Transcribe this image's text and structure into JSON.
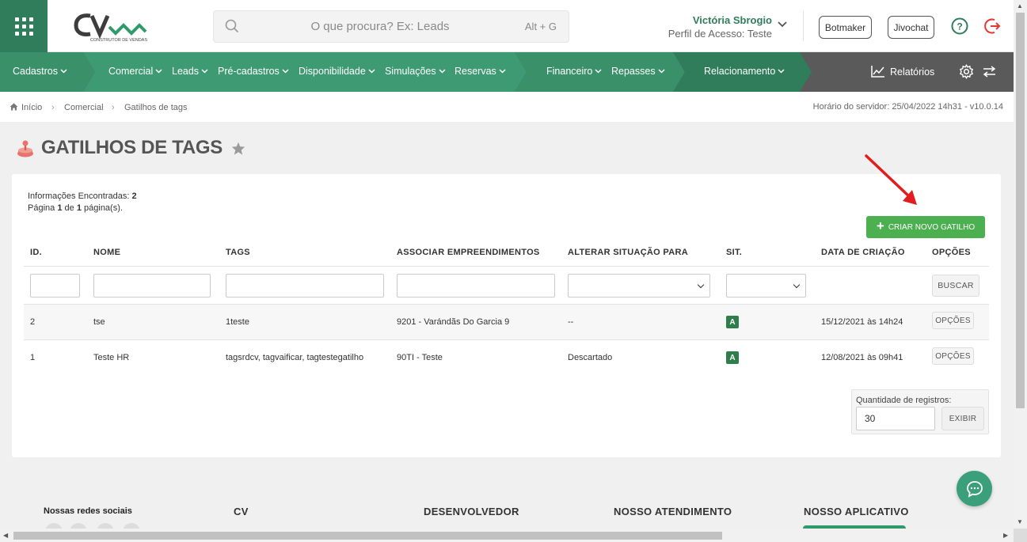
{
  "header": {
    "search_placeholder": "O que procura? Ex: Leads",
    "search_shortcut": "Alt + G",
    "user_name": "Victória Sbrogio",
    "user_profile": "Perfil de Acesso: Teste",
    "botmaker_label": "Botmaker",
    "jivochat_label": "Jivochat",
    "logo_text": "CONSTRUTOR DE VENDAS",
    "brand_color": "#2f7d5a"
  },
  "nav": {
    "items": [
      {
        "label": "Cadastros"
      },
      {
        "label": "Comercial"
      },
      {
        "label": "Leads"
      },
      {
        "label": "Pré-cadastros"
      },
      {
        "label": "Disponibilidade"
      },
      {
        "label": "Simulações"
      },
      {
        "label": "Reservas"
      },
      {
        "label": "Financeiro"
      },
      {
        "label": "Repasses"
      },
      {
        "label": "Relacionamento"
      }
    ],
    "reports_label": "Relatórios"
  },
  "breadcrumb": {
    "items": [
      "Início",
      "Comercial",
      "Gatilhos de tags"
    ],
    "server_time": "Horário do servidor: 25/04/2022 14h31 - v10.0.14"
  },
  "page": {
    "title": "GATILHOS DE TAGS",
    "info_found_label": "Informações Encontradas:",
    "info_found_count": "2",
    "page_label_1": "Página",
    "page_current": "1",
    "page_label_2": "de",
    "page_total": "1",
    "page_label_3": "página(s).",
    "create_button": "CRIAR NOVO GATILHO",
    "search_button": "BUSCAR"
  },
  "table": {
    "columns": [
      "ID.",
      "NOME",
      "TAGS",
      "ASSOCIAR EMPREENDIMENTOS",
      "ALTERAR SITUAÇÃO PARA",
      "SIT.",
      "DATA DE CRIAÇÃO",
      "OPÇÕES"
    ],
    "rows": [
      {
        "id": "2",
        "name": "tse",
        "tags": "1teste",
        "enterprise": "9201 - Varándãs Do Garcia 9",
        "status_change": "--",
        "sit": "A",
        "created": "15/12/2021 às 14h24",
        "options": "OPÇÕES"
      },
      {
        "id": "1",
        "name": "Teste HR",
        "tags": "tagsrdcv, tagvaificar, tagtestegatilho",
        "enterprise": "90TI - Teste",
        "status_change": "Descartado",
        "sit": "A",
        "created": "12/08/2021 às 09h41",
        "options": "OPÇÕES"
      }
    ]
  },
  "records": {
    "label": "Quantidade de registros:",
    "value": "30",
    "button": "EXIBIR"
  },
  "footer": {
    "social_label": "Nossas redes sociais",
    "columns": [
      "CV",
      "DESENVOLVEDOR",
      "NOSSO ATENDIMENTO",
      "NOSSO APLICATIVO"
    ]
  }
}
